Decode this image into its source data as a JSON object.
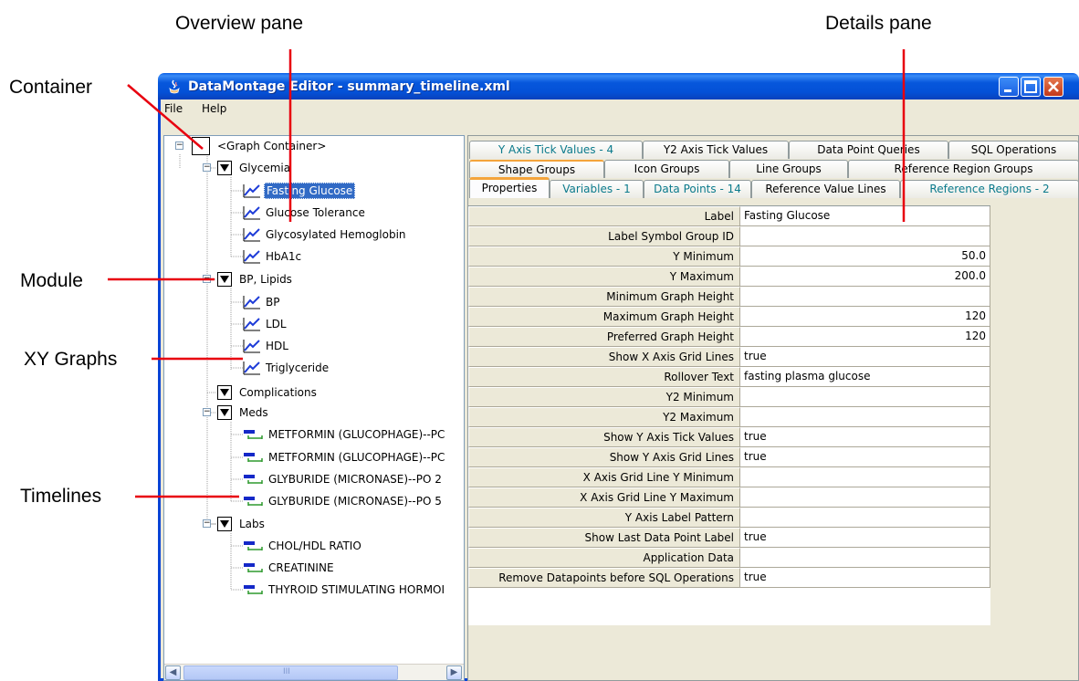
{
  "callouts": {
    "overview": "Overview pane",
    "details": "Details pane",
    "container": "Container",
    "module": "Module",
    "xy_graphs": "XY Graphs",
    "timelines": "Timelines"
  },
  "window": {
    "title": "DataMontage Editor - summary_timeline.xml",
    "menu": [
      "File",
      "Help"
    ]
  },
  "tree": {
    "root": "<Graph Container>",
    "items": [
      {
        "label": "Glycemia",
        "type": "module"
      },
      {
        "label": "Fasting Glucose",
        "type": "graph",
        "selected": true
      },
      {
        "label": "Glucose Tolerance",
        "type": "graph"
      },
      {
        "label": "Glycosylated Hemoglobin",
        "type": "graph"
      },
      {
        "label": "HbA1c",
        "type": "graph"
      },
      {
        "label": "BP, Lipids",
        "type": "module"
      },
      {
        "label": "BP",
        "type": "graph"
      },
      {
        "label": "LDL",
        "type": "graph"
      },
      {
        "label": "HDL",
        "type": "graph"
      },
      {
        "label": "Triglyceride",
        "type": "graph"
      },
      {
        "label": "Complications",
        "type": "module"
      },
      {
        "label": "Meds",
        "type": "module"
      },
      {
        "label": "METFORMIN (GLUCOPHAGE)--PC",
        "type": "timeline"
      },
      {
        "label": "METFORMIN (GLUCOPHAGE)--PC",
        "type": "timeline"
      },
      {
        "label": "GLYBURIDE (MICRONASE)--PO 2",
        "type": "timeline"
      },
      {
        "label": "GLYBURIDE (MICRONASE)--PO 5",
        "type": "timeline"
      },
      {
        "label": "Labs",
        "type": "module"
      },
      {
        "label": "CHOL/HDL RATIO",
        "type": "timeline"
      },
      {
        "label": "CREATININE",
        "type": "timeline"
      },
      {
        "label": "THYROID STIMULATING HORMOI",
        "type": "timeline"
      }
    ],
    "scroll_thumb_label": "III"
  },
  "tabs": {
    "row1": [
      "Y Axis Tick Values - 4",
      "Y2 Axis Tick Values",
      "Data Point Queries",
      "SQL Operations"
    ],
    "row2": [
      "Shape Groups",
      "Icon Groups",
      "Line Groups",
      "Reference Region Groups"
    ],
    "row3": [
      "Properties",
      "Variables - 1",
      "Data Points - 14",
      "Reference Value Lines",
      "Reference Regions - 2"
    ]
  },
  "properties": [
    {
      "name": "Label",
      "value": "Fasting Glucose"
    },
    {
      "name": "Label Symbol Group ID",
      "value": ""
    },
    {
      "name": "Y Minimum",
      "value": "50.0",
      "num": true
    },
    {
      "name": "Y Maximum",
      "value": "200.0",
      "num": true
    },
    {
      "name": "Minimum Graph Height",
      "value": ""
    },
    {
      "name": "Maximum Graph Height",
      "value": "120",
      "num": true
    },
    {
      "name": "Preferred Graph Height",
      "value": "120",
      "num": true
    },
    {
      "name": "Show X Axis Grid Lines",
      "value": "true"
    },
    {
      "name": "Rollover Text",
      "value": "fasting plasma glucose"
    },
    {
      "name": "Y2 Minimum",
      "value": ""
    },
    {
      "name": "Y2 Maximum",
      "value": ""
    },
    {
      "name": "Show Y Axis Tick Values",
      "value": "true"
    },
    {
      "name": "Show Y Axis Grid Lines",
      "value": "true"
    },
    {
      "name": "X Axis Grid Line Y Minimum",
      "value": ""
    },
    {
      "name": "X Axis Grid Line Y Maximum",
      "value": ""
    },
    {
      "name": "Y Axis Label Pattern",
      "value": ""
    },
    {
      "name": "Show Last Data Point Label",
      "value": "true"
    },
    {
      "name": "Application Data",
      "value": ""
    },
    {
      "name": "Remove Datapoints before SQL Operations",
      "value": "true"
    }
  ],
  "colors": {
    "callout_arrow": "#e8000f",
    "titlebar": "#0451d7",
    "selection": "#316ac5",
    "timeline_bar": "#1428c8",
    "timeline_tick": "#2e9a2e",
    "graph_line": "#1e3cd8"
  }
}
